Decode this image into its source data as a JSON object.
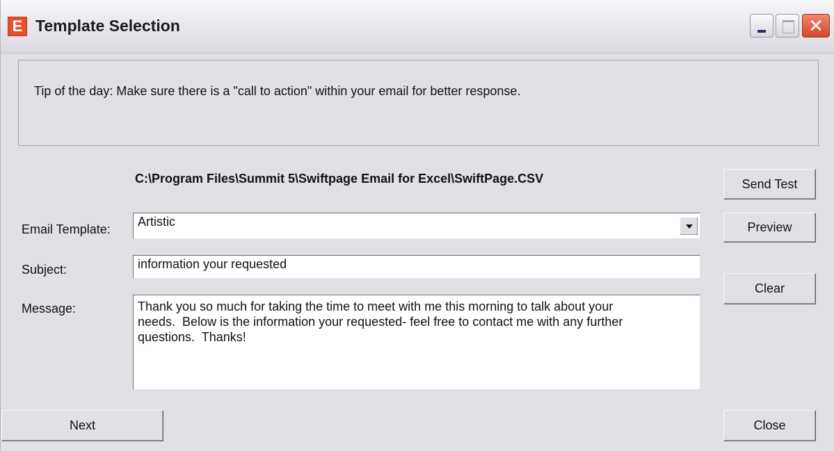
{
  "window": {
    "title": "Template Selection",
    "app_icon_letter": "E",
    "controls": {
      "minimize": "minimize",
      "maximize": "maximize",
      "close": "close"
    }
  },
  "tip": {
    "text": "Tip of the day: Make sure there is a \"call to action\" within your email for better response."
  },
  "file_path": "C:\\Program Files\\Summit 5\\Swiftpage Email for Excel\\SwiftPage.CSV",
  "form": {
    "email_template_label": "Email Template:",
    "email_template_value": "Artistic",
    "subject_label": "Subject:",
    "subject_value": "information your requested",
    "message_label": "Message:",
    "message_value": "Thank you so much for taking the time to meet with me this morning to talk about your\nneeds.  Below is the information your requested- feel free to contact me with any further\nquestions.  Thanks!"
  },
  "buttons": {
    "send_test": "Send Test",
    "preview": "Preview",
    "clear": "Clear",
    "next": "Next",
    "close": "Close"
  }
}
